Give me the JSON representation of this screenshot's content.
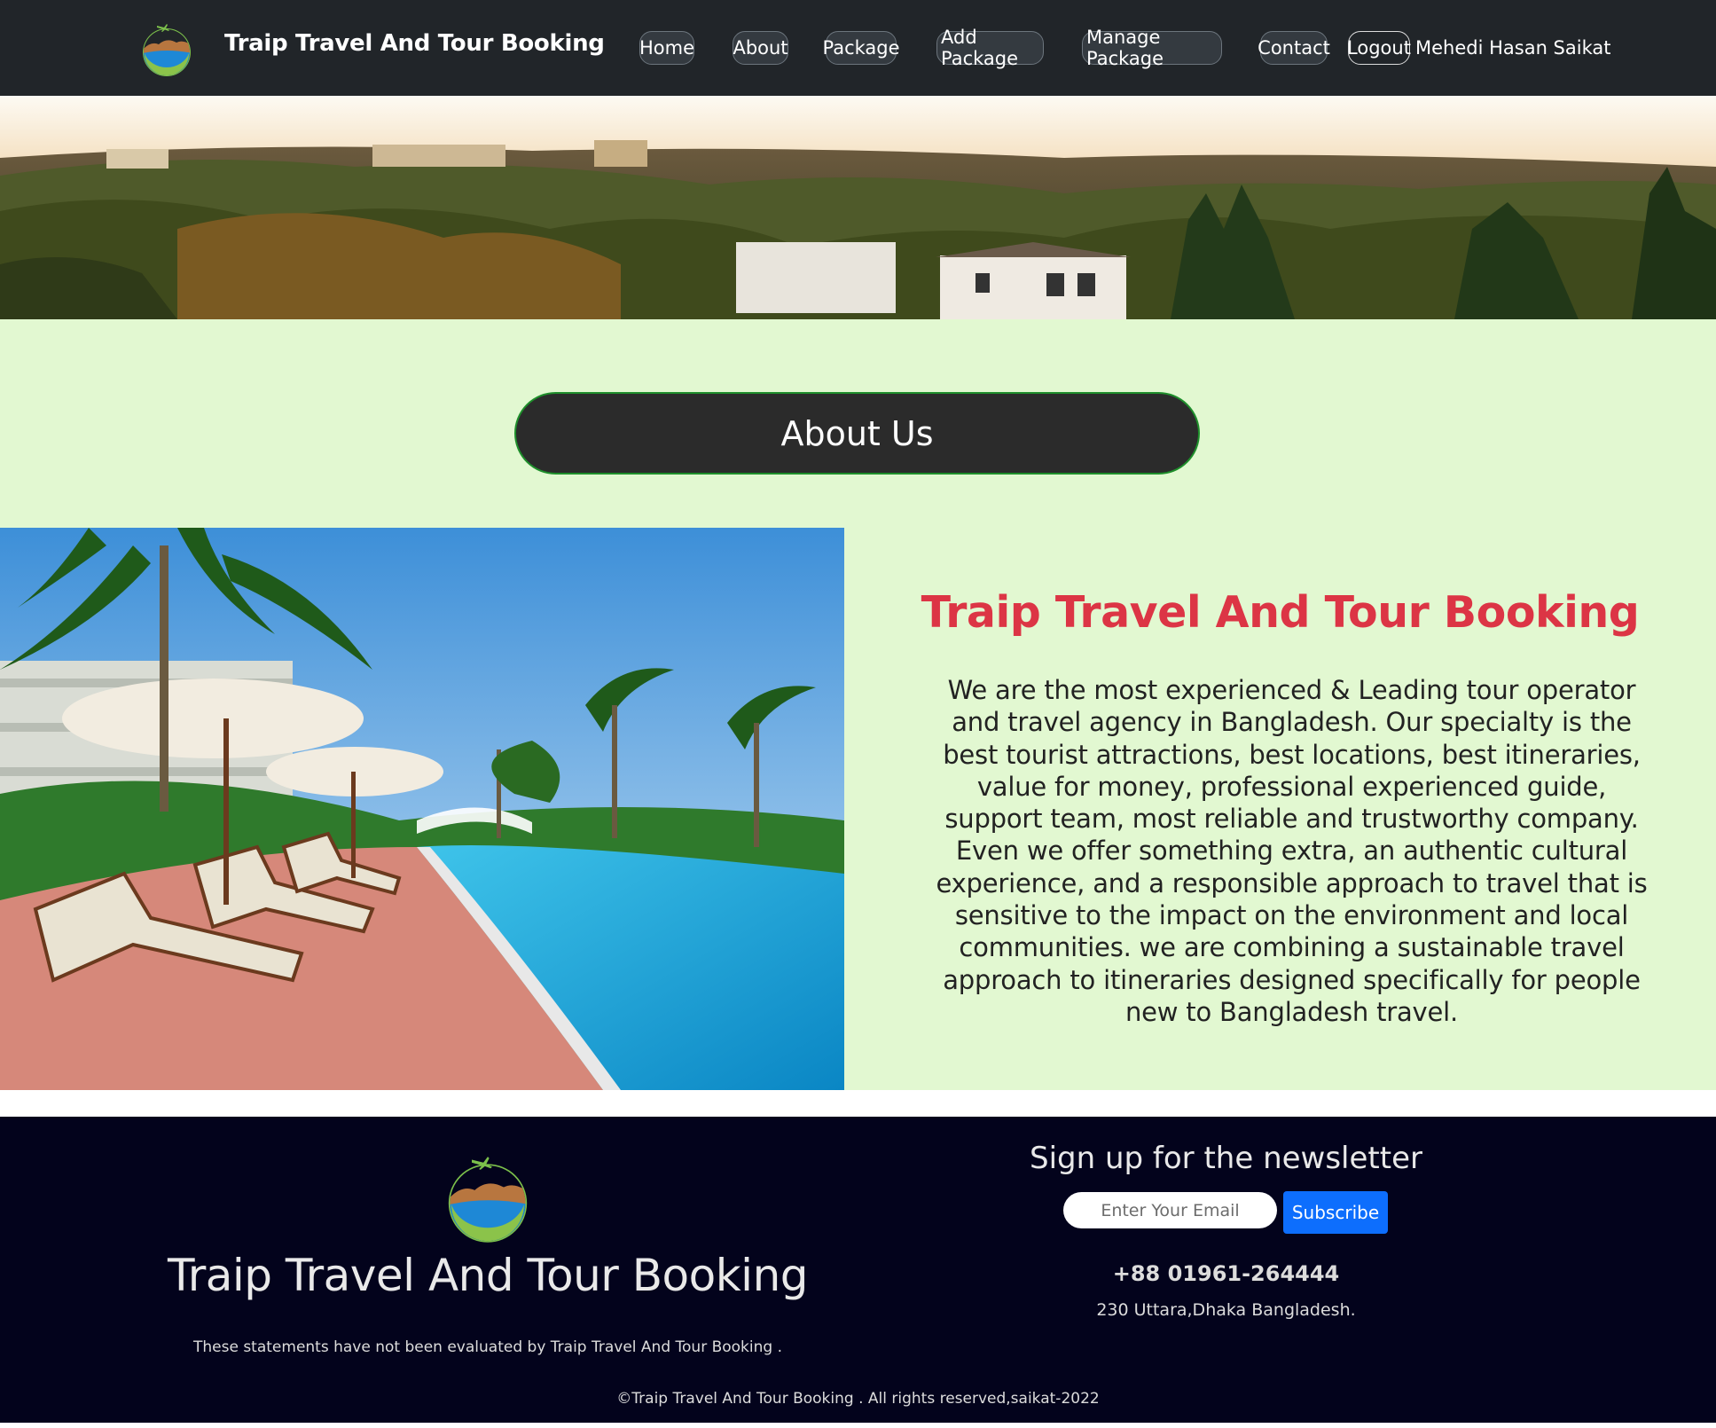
{
  "navbar": {
    "brand_name": "Traip Travel And Tour Booking",
    "links": [
      {
        "label": "Home"
      },
      {
        "label": "About"
      },
      {
        "label": "Package"
      },
      {
        "label": "Add Package"
      },
      {
        "label": "Manage Package"
      },
      {
        "label": "Contact"
      }
    ],
    "logout_label": "Logout",
    "user_name": "Mehedi Hasan Saikat"
  },
  "about": {
    "section_title": "About Us",
    "heading": "Traip Travel And Tour Booking",
    "description": "We are the most experienced & Leading tour operator and travel agency in Bangladesh. Our specialty is the best tourist attractions, best locations, best itineraries, value for money, professional experienced guide, support team, most reliable and trustworthy company. Even we offer something extra, an authentic cultural experience, and a responsible approach to travel that is sensitive to the impact on the environment and local communities. we are combining a sustainable travel approach to itineraries designed specifically for people new to Bangladesh travel."
  },
  "footer": {
    "brand_name": "Traip Travel And Tour Booking",
    "disclaimer": "These statements have not been evaluated by Traip Travel And Tour Booking .",
    "newsletter_title": "Sign up for the newsletter",
    "email_placeholder": "Enter Your Email",
    "subscribe_label": "Subscribe",
    "phone": "+88 01961-264444",
    "address": "230 Uttara,Dhaka Bangladesh.",
    "copyright": "©Traip Travel And Tour Booking . All rights reserved,saikat-2022"
  },
  "colors": {
    "navbar_bg": "#212529",
    "section_bg": "#e2f8d1",
    "heading_accent": "#dc3545",
    "footer_bg": "#03031c",
    "subscribe_bg": "#0d6efd"
  },
  "icons": {
    "brand_logo": "travel-logo-icon",
    "footer_logo": "travel-logo-icon"
  }
}
